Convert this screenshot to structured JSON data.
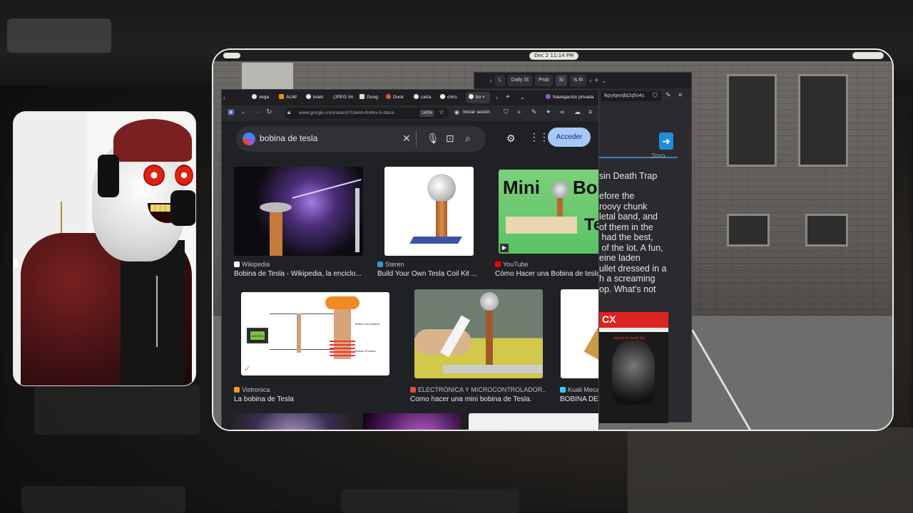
{
  "taskbar": {
    "clock": "Dec 2  11:14 PM"
  },
  "back_window": {
    "tabs": [
      "L",
      "Daily St",
      "Prob",
      "Si",
      "Is th"
    ],
    "url_fragment": "lkpylqwxjbj2q5o4s",
    "timestamp": "2mo",
    "title": "sin Death Trap",
    "body": "efore the\nroovy chunk\nletal band, and\nof them in the\n had the best,\n of the lot. A fun,\neine laden\nullet dressed in a\nh a screaming\nop. What's not",
    "album": {
      "header": "CX",
      "subtitle": "wisconsin death trip"
    }
  },
  "front_window": {
    "tabs": [
      "vega",
      "ALM/",
      "brain",
      "(JPEG Im",
      "Goog",
      "Duck",
      "carta",
      "chris",
      "bo"
    ],
    "private_label": "Navegación privada",
    "url": "www.google.com/search?client=firefox-b-d&ca",
    "zoom": "140%",
    "login": "Iniciar sesión",
    "search_query": "bobina de tesla",
    "acceder_label": "Acceder",
    "results": [
      {
        "source": "Wikipedia",
        "caption": "Bobina de Tesla - Wikipedia, la enciclo..."
      },
      {
        "source": "Steren",
        "caption": "Build Your Own Tesla Coil Kit ..."
      },
      {
        "source": "YouTube",
        "caption": "Cómo Hacer una Bobina de tesla"
      },
      {
        "source": "Vistronica",
        "caption": "La bobina de Tesla"
      },
      {
        "source": "ELECTRÓNICA Y MICROCONTROLADOR...",
        "caption": "Como hacer una mini bobina de Tesla."
      },
      {
        "source": "Kuali Mecat",
        "caption": "BOBINA DE"
      }
    ],
    "thumb_mini_text": "Mini",
    "thumb_bo_text": "Bo",
    "thumb_te_text": "Te",
    "diagram_labels": {
      "battery": "BATERIA",
      "secondary": "Bobina Secundaria",
      "primary": "Bobina Primaria"
    }
  },
  "colors": {
    "accent": "#a8c7fa",
    "google_bg": "#202124"
  }
}
